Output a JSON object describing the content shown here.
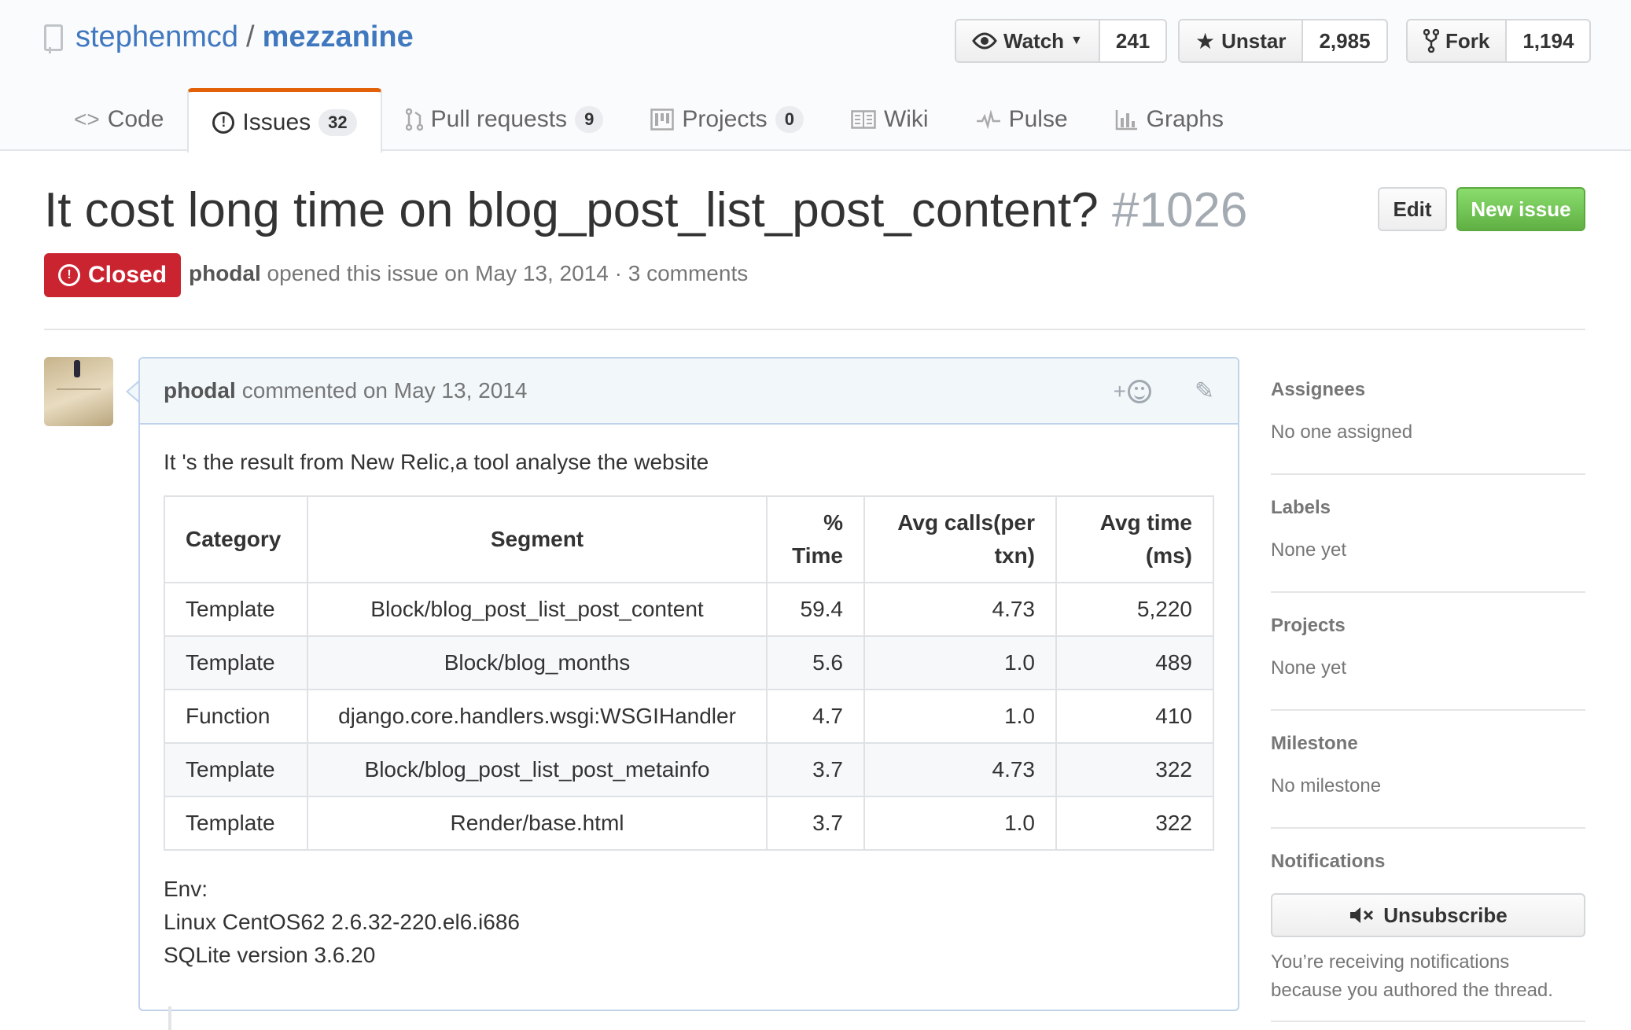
{
  "repo": {
    "owner": "stephenmcd",
    "separator": "/",
    "name": "mezzanine",
    "watch": {
      "label": "Watch",
      "count": "241"
    },
    "star": {
      "label": "Unstar",
      "count": "2,985"
    },
    "fork": {
      "label": "Fork",
      "count": "1,194"
    }
  },
  "tabs": [
    {
      "label": "Code",
      "icon": "code-icon"
    },
    {
      "label": "Issues",
      "count": "32",
      "icon": "issue-opened-icon"
    },
    {
      "label": "Pull requests",
      "count": "9",
      "icon": "git-pull-request-icon"
    },
    {
      "label": "Projects",
      "count": "0",
      "icon": "project-icon"
    },
    {
      "label": "Wiki",
      "icon": "book-icon"
    },
    {
      "label": "Pulse",
      "icon": "pulse-icon"
    },
    {
      "label": "Graphs",
      "icon": "graph-icon"
    }
  ],
  "issue": {
    "title": "It cost long time on blog_post_list_post_content?",
    "number": "#1026",
    "edit_label": "Edit",
    "new_label": "New issue",
    "state": "Closed",
    "author": "phodal",
    "meta_text": "opened this issue on May 13, 2014 · 3 comments"
  },
  "comment": {
    "author": "phodal",
    "when": "commented on May 13, 2014",
    "reaction_plus": "+",
    "intro": "It 's the result from New Relic,a tool analyse the website",
    "table": {
      "headers": {
        "category": "Category",
        "segment": "Segment",
        "pct_line1": "%",
        "pct_line2": "Time",
        "calls_line1": "Avg calls(per",
        "calls_line2": "txn)",
        "avg_line1": "Avg time",
        "avg_line2": "(ms)"
      },
      "rows": [
        {
          "category": "Template",
          "segment": "Block/blog_post_list_post_content",
          "pct": "59.4",
          "calls": "4.73",
          "avg": "5,220"
        },
        {
          "category": "Template",
          "segment": "Block/blog_months",
          "pct": "5.6",
          "calls": "1.0",
          "avg": "489"
        },
        {
          "category": "Function",
          "segment": "django.core.handlers.wsgi:WSGIHandler",
          "pct": "4.7",
          "calls": "1.0",
          "avg": "410"
        },
        {
          "category": "Template",
          "segment": "Block/blog_post_list_post_metainfo",
          "pct": "3.7",
          "calls": "4.73",
          "avg": "322"
        },
        {
          "category": "Template",
          "segment": "Render/base.html",
          "pct": "3.7",
          "calls": "1.0",
          "avg": "322"
        }
      ]
    },
    "env_label": "Env:",
    "env_lines": [
      "Linux CentOS62 2.6.32-220.el6.i686",
      "SQLite version 3.6.20"
    ]
  },
  "sidebar": {
    "assignees": {
      "heading": "Assignees",
      "value": "No one assigned"
    },
    "labels": {
      "heading": "Labels",
      "value": "None yet"
    },
    "projects": {
      "heading": "Projects",
      "value": "None yet"
    },
    "milestone": {
      "heading": "Milestone",
      "value": "No milestone"
    },
    "notifications": {
      "heading": "Notifications",
      "button": "Unsubscribe",
      "reason_line1": "You’re receiving notifications",
      "reason_line2": "because you authored the thread."
    }
  },
  "colors": {
    "link": "#4078c0",
    "closed": "#cb2431",
    "new_issue": "#6cc644",
    "tab_accent": "#e36209"
  }
}
